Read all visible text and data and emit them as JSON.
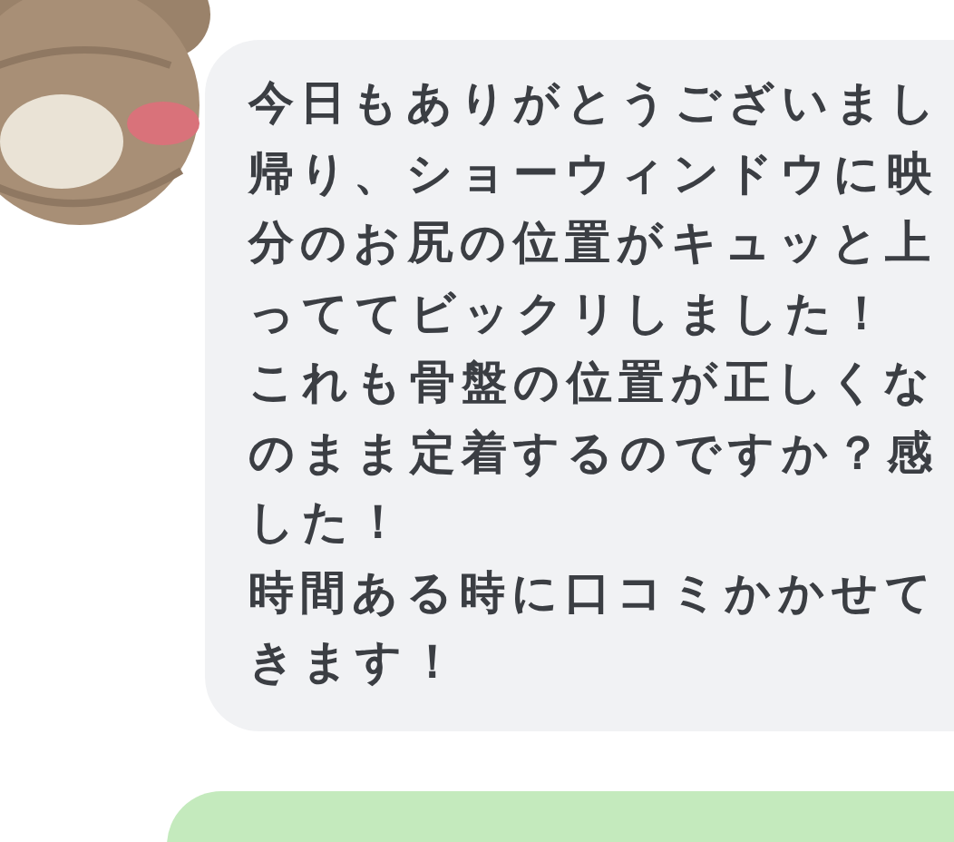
{
  "messages": [
    {
      "kind": "received",
      "lines": [
        "今日もありがとうございまし",
        "帰り、ショーウィンドウに映",
        "分のお尻の位置がキュッと上",
        "っててビックリしました！",
        "これも骨盤の位置が正しくな",
        "のまま定着するのですか？感",
        "した！",
        "時間ある時に口コミかかせて",
        "きます！"
      ]
    },
    {
      "kind": "sent"
    }
  ]
}
